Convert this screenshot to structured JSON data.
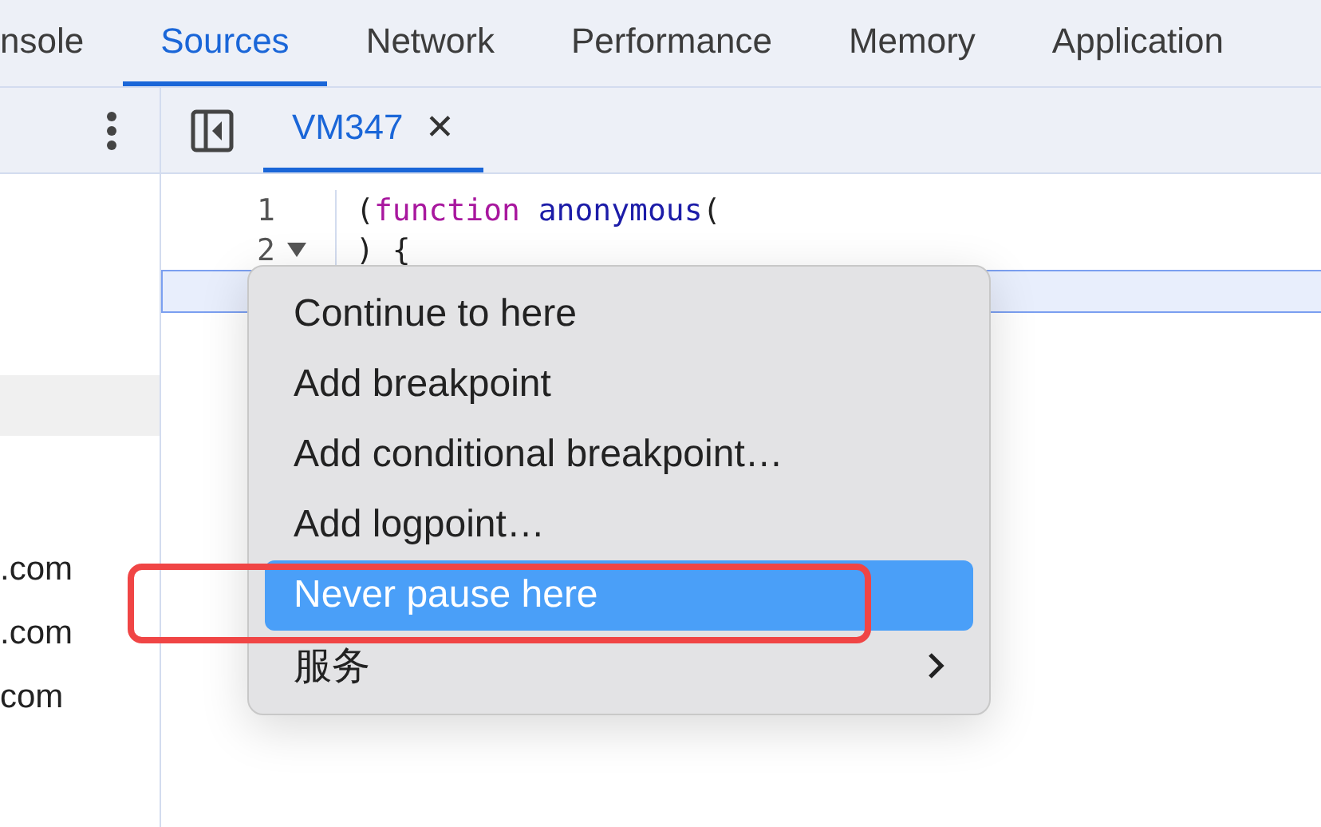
{
  "tabs": [
    {
      "label": "nsole",
      "selected": false
    },
    {
      "label": "Sources",
      "selected": true
    },
    {
      "label": "Network",
      "selected": false
    },
    {
      "label": "Performance",
      "selected": false
    },
    {
      "label": "Memory",
      "selected": false
    },
    {
      "label": "Application",
      "selected": false
    }
  ],
  "navigator": {
    "items": [
      {
        "selected": true
      },
      {
        "label": ".com",
        "selected": false
      },
      {
        "label": ".com",
        "selected": false
      },
      {
        "label": "com",
        "selected": false
      }
    ]
  },
  "editor_tabs": [
    {
      "label": "VM347",
      "selected": true,
      "close": "✕"
    }
  ],
  "code": {
    "lines": [
      {
        "number": "1",
        "foldable": false,
        "parts": [
          {
            "kind": "punct",
            "text": "("
          },
          {
            "kind": "keyword",
            "text": "function"
          },
          {
            "kind": "name",
            "text": "anonymous"
          },
          {
            "kind": "punct",
            "text": "("
          }
        ]
      },
      {
        "number": "2",
        "foldable": true,
        "parts": [
          {
            "kind": "punct",
            "text": ") {"
          }
        ]
      },
      {
        "highlighted": true
      }
    ]
  },
  "context_menu": {
    "items": [
      {
        "kind": "item",
        "label": "Continue to here",
        "selected": false
      },
      {
        "kind": "item",
        "label": "Add breakpoint",
        "selected": false
      },
      {
        "kind": "item",
        "label": "Add conditional breakpoint…",
        "selected": false
      },
      {
        "kind": "item",
        "label": "Add logpoint…",
        "selected": false
      },
      {
        "kind": "item",
        "label": "Never pause here",
        "selected": true
      },
      {
        "kind": "submenu",
        "label": "服务",
        "selected": false
      }
    ]
  }
}
